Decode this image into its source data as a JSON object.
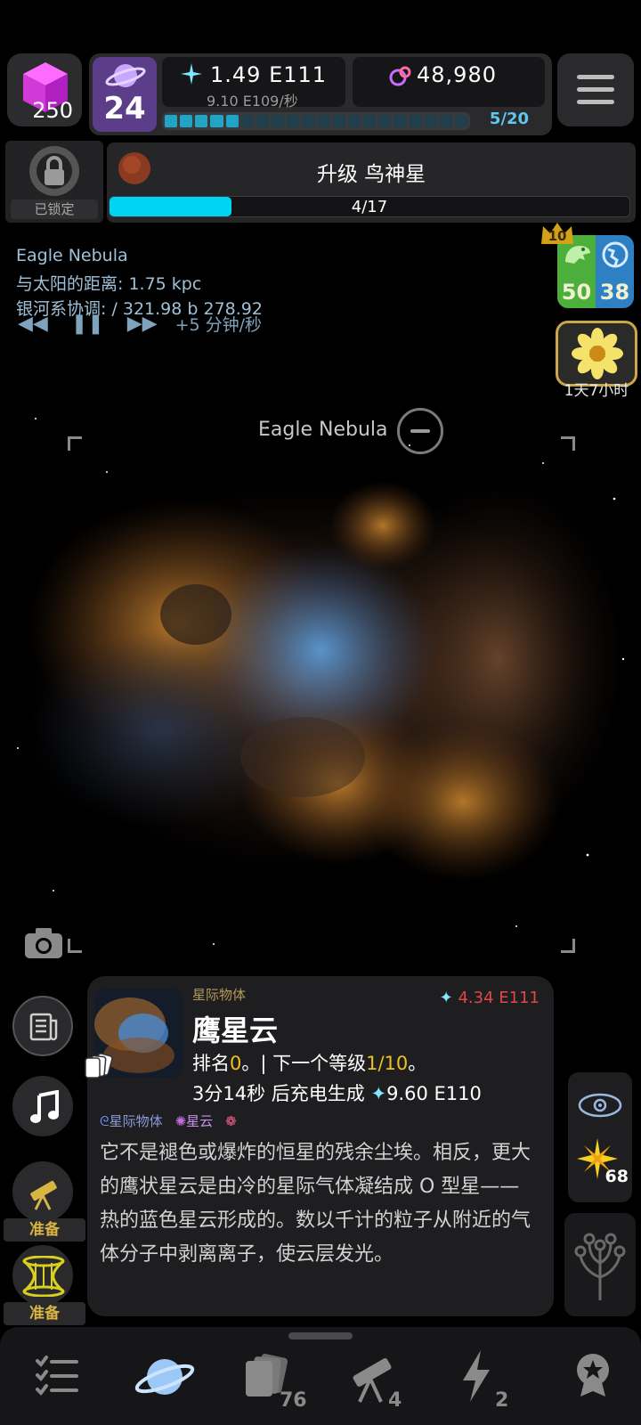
{
  "top": {
    "cube_count": "250",
    "level": "24",
    "stardust": "1.49 E111",
    "stardust_rate": "9.10 E109/秒",
    "dark_matter": "48,980",
    "progress": {
      "text": "5/20",
      "filled": 5,
      "total": 20
    }
  },
  "upgrade": {
    "locked_label": "已锁定",
    "title": "升级 鸟神星",
    "progress_text": "4/17",
    "progress_fraction": 0.235
  },
  "location": {
    "name": "Eagle Nebula",
    "distance": "与太阳的距离: 1.75 kpc",
    "coords": "银河系协调: / 321.98 b 278.92",
    "time_rate": "+5 分钟/秒"
  },
  "badges": {
    "crown_level": "10",
    "green_count": "50",
    "blue_count": "38",
    "timer": "1天7小时"
  },
  "viewer": {
    "target_label": "Eagle Nebula"
  },
  "card": {
    "category": "星际物体",
    "title": "鹰星云",
    "value": "4.34 E111",
    "rank_prefix": "排名",
    "rank_value": "0",
    "rank_mid": "。| 下一个等级",
    "rank_next": "1/10",
    "rank_suffix": "。",
    "charge_text": "3分14秒 后充电生成",
    "charge_value": "9.60 E110",
    "tags": [
      "星际物体",
      "星云"
    ],
    "description": "它不是褪色或爆炸的恒星的残余尘埃。相反，更大的鹰状星云是由冷的星际气体凝结成 O 型星——热的蓝色星云形成的。数以千计的粒子从附近的气体分子中剥离离子，使云层发光。",
    "side_count": "68"
  },
  "left_buttons": {
    "ready_label_1": "准备",
    "ready_label_2": "准备"
  },
  "nav": {
    "cards_count": "76",
    "telescope_count": "4",
    "energy_count": "2"
  },
  "colors": {
    "accent_cyan": "#00d4f5",
    "level_purple": "#5b3d8a",
    "ready_gold": "#d8b443",
    "value_red": "#e04848"
  }
}
